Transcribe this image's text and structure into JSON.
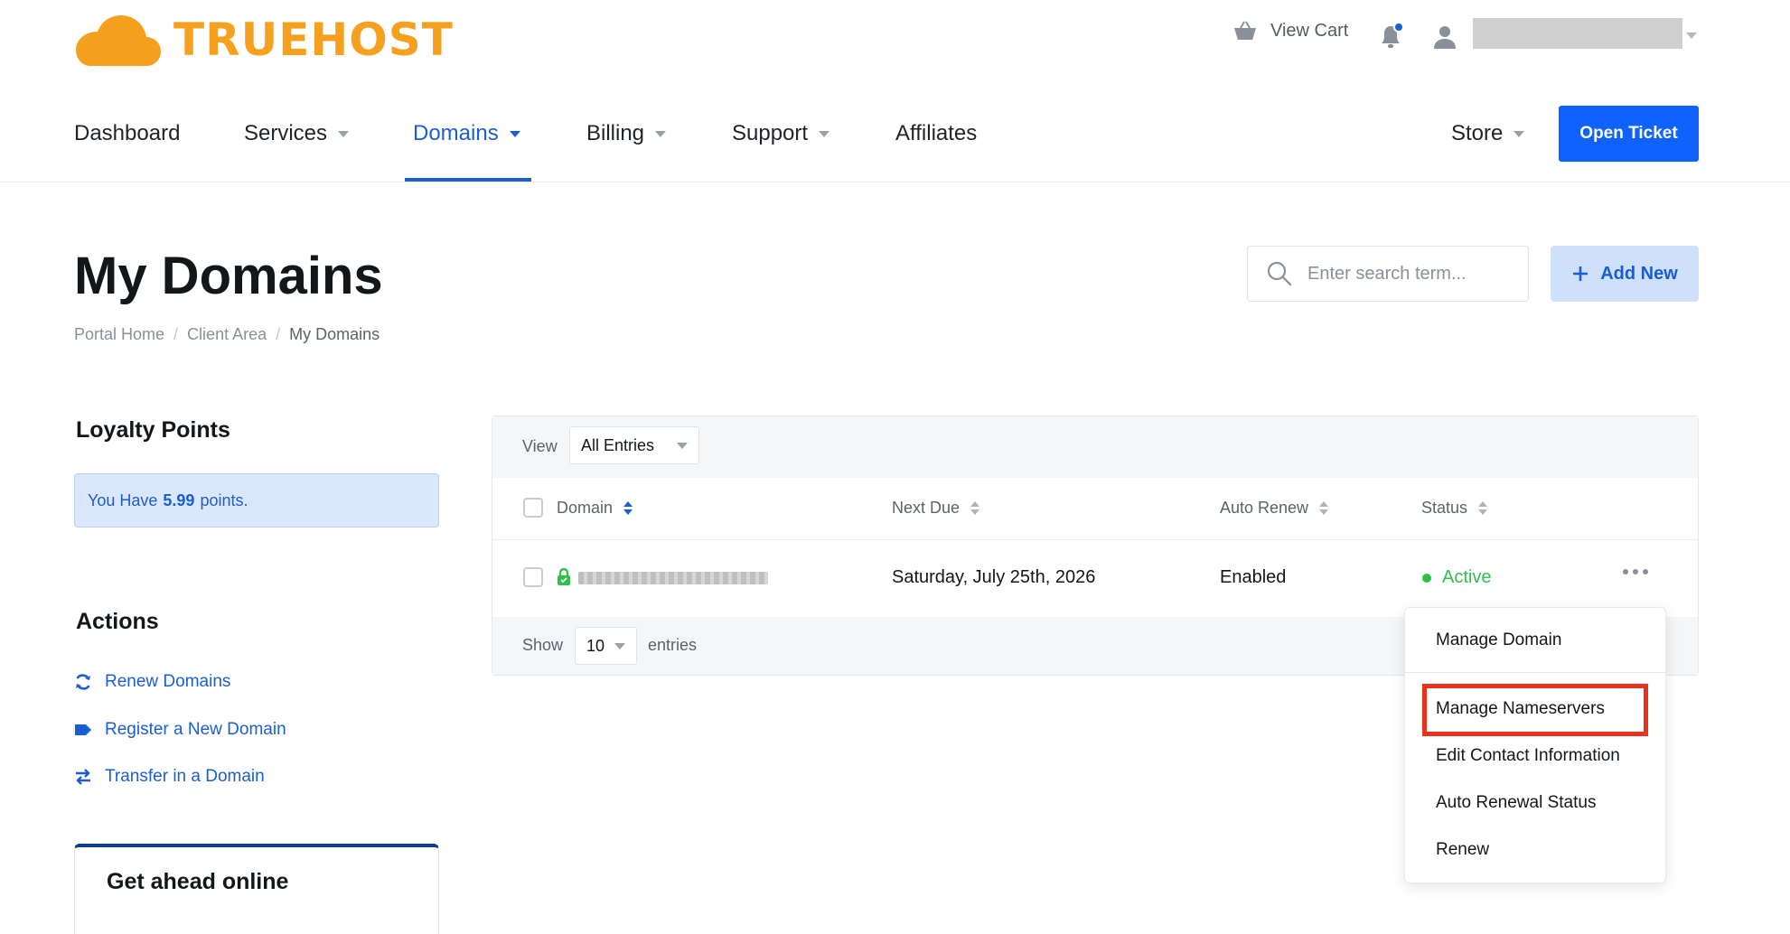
{
  "brand": {
    "name": "TRUEHOST",
    "logo_color": "#f5a11f"
  },
  "header": {
    "cart_label": "View Cart",
    "icons": [
      "basket-icon",
      "bell-icon",
      "user-icon"
    ],
    "notification_dot_color": "#1a5ed6"
  },
  "nav": {
    "items": [
      {
        "label": "Dashboard",
        "has_caret": false
      },
      {
        "label": "Services",
        "has_caret": true
      },
      {
        "label": "Domains",
        "has_caret": true,
        "active": true
      },
      {
        "label": "Billing",
        "has_caret": true
      },
      {
        "label": "Support",
        "has_caret": true
      },
      {
        "label": "Affiliates",
        "has_caret": false
      }
    ],
    "store_label": "Store",
    "open_ticket_label": "Open Ticket",
    "accent_color": "#0f62fe"
  },
  "page": {
    "title": "My Domains",
    "breadcrumb": [
      "Portal Home",
      "Client Area",
      "My Domains"
    ],
    "search_placeholder": "Enter search term...",
    "add_new_label": "Add New"
  },
  "sidebar": {
    "loyalty_title": "Loyalty Points",
    "loyalty_prefix": "You Have",
    "loyalty_points": "5.99",
    "loyalty_suffix": "points.",
    "actions_title": "Actions",
    "actions": [
      {
        "label": "Renew Domains",
        "icon": "sync-icon"
      },
      {
        "label": "Register a New Domain",
        "icon": "tag-icon"
      },
      {
        "label": "Transfer in a Domain",
        "icon": "transfer-icon"
      }
    ],
    "promo_title": "Get ahead online"
  },
  "table": {
    "view_label": "View",
    "view_selected": "All Entries",
    "columns": [
      "Domain",
      "Next Due",
      "Auto Renew",
      "Status"
    ],
    "rows": [
      {
        "next_due": "Saturday, July 25th, 2026",
        "auto_renew": "Enabled",
        "status": "Active",
        "status_color": "#2fbf4a"
      }
    ],
    "show_label": "Show",
    "page_size": "10",
    "entries_label": "entries"
  },
  "row_menu": {
    "items": [
      "Manage Domain",
      "Manage Nameservers",
      "Edit Contact Information",
      "Auto Renewal Status",
      "Renew"
    ],
    "highlighted": "Manage Nameservers",
    "highlight_color": "#e8321d"
  }
}
